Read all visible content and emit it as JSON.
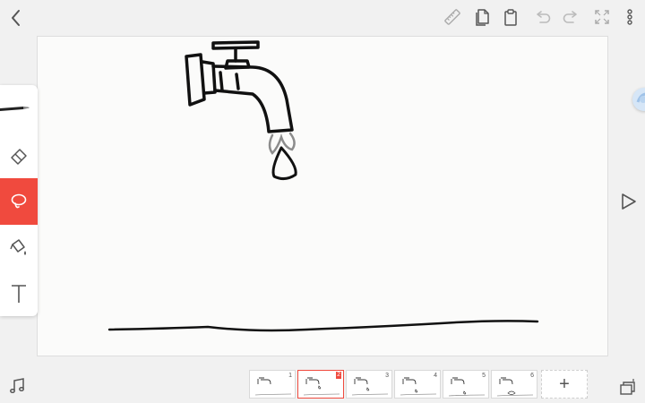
{
  "toolbar": {
    "icons": [
      "back-icon",
      "ruler-icon",
      "pages-icon",
      "clipboard-icon",
      "undo-icon",
      "redo-icon",
      "fullscreen-icon",
      "more-icon"
    ]
  },
  "tools": {
    "items": [
      "pen-icon",
      "eraser-icon",
      "lasso-icon",
      "fill-bucket-icon",
      "text-icon"
    ],
    "selected": "lasso-icon",
    "accent_color": "#f04a3e"
  },
  "timeline": {
    "frames": [
      {
        "number": "1"
      },
      {
        "number": "2"
      },
      {
        "number": "3"
      },
      {
        "number": "4"
      },
      {
        "number": "5"
      },
      {
        "number": "6"
      }
    ],
    "current_frame": "2",
    "add_label": "+"
  },
  "colors": {
    "canvas": "#fbfbfa",
    "background": "#f1f1f1",
    "ink": "#111111"
  }
}
